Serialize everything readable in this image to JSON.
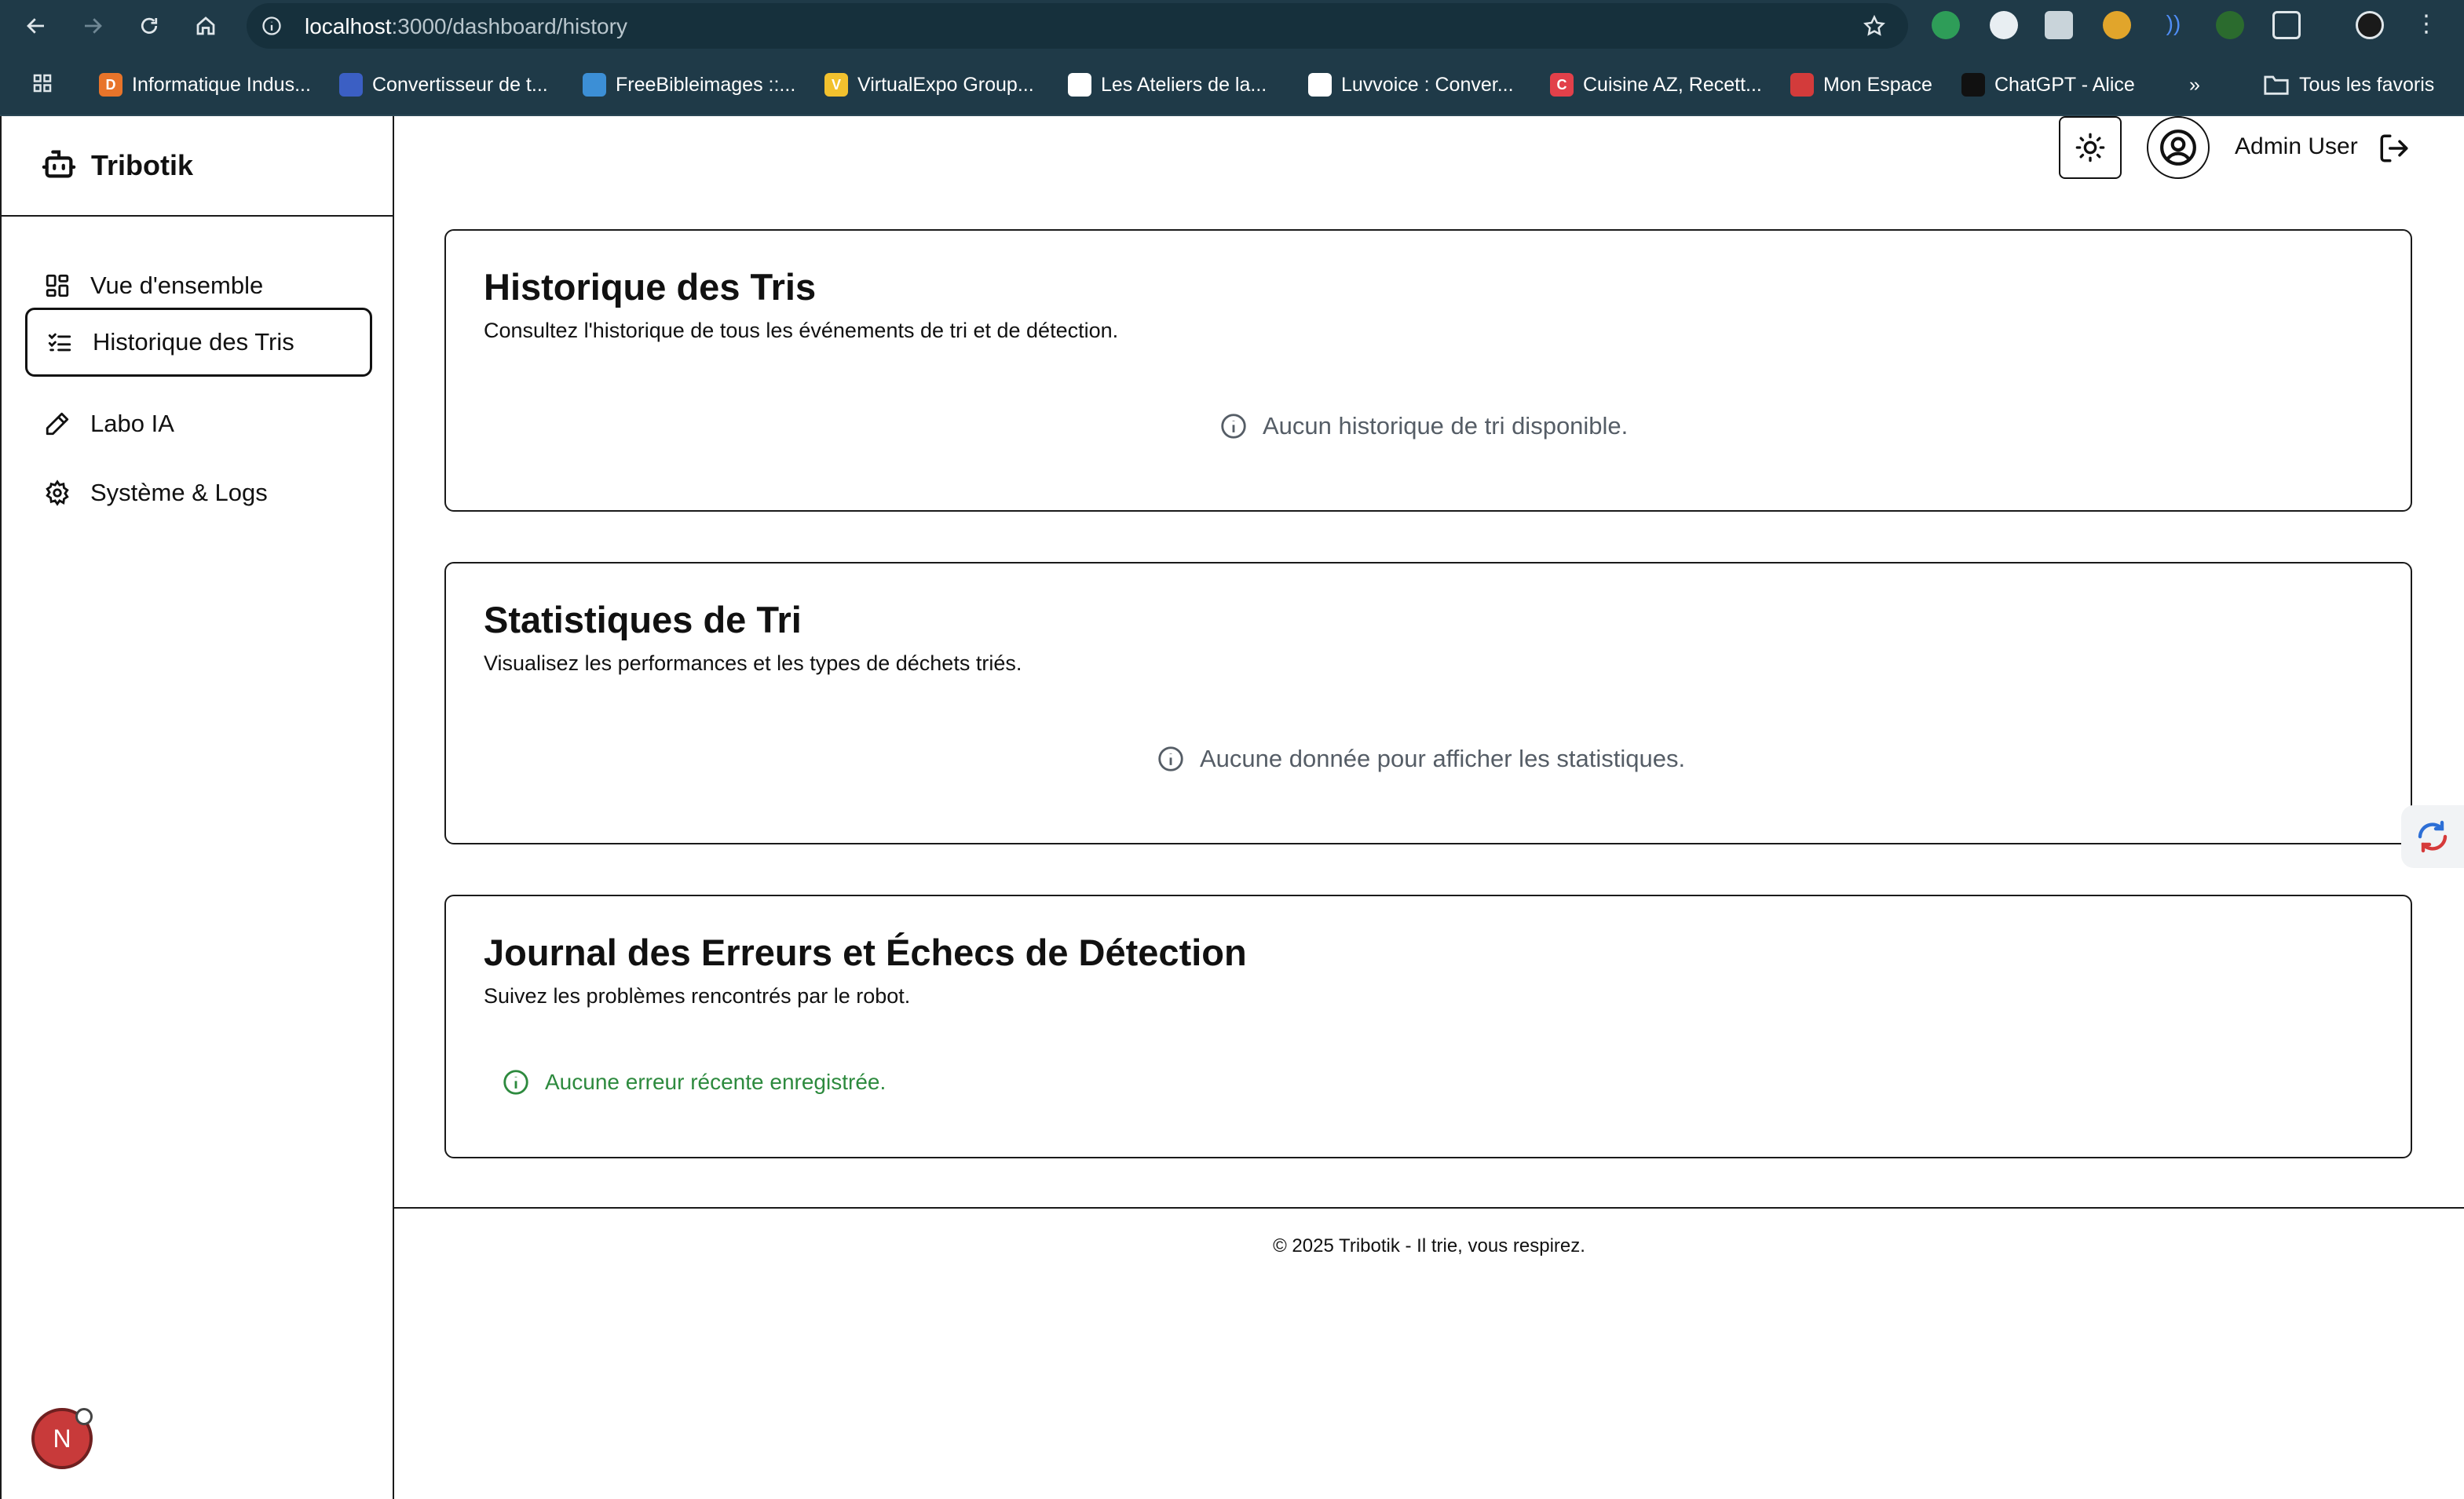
{
  "browser": {
    "url_host": "localhost",
    "url_path": ":3000/dashboard/history",
    "bookmarks": [
      {
        "label": "Informatique Indus...",
        "color": "#e8742a",
        "glyph": "D"
      },
      {
        "label": "Convertisseur de t...",
        "color": "#3b5fc4",
        "glyph": ""
      },
      {
        "label": "FreeBibleimages ::...",
        "color": "#3c8fd6",
        "glyph": ""
      },
      {
        "label": "VirtualExpo Group...",
        "color": "#f2c12e",
        "glyph": "V"
      },
      {
        "label": "Les Ateliers de la...",
        "color": "#ffffff",
        "glyph": ""
      },
      {
        "label": "Luvvoice : Conver...",
        "color": "#ffffff",
        "glyph": ""
      },
      {
        "label": "Cuisine AZ, Recett...",
        "color": "#e2404a",
        "glyph": "C"
      },
      {
        "label": "Mon Espace",
        "color": "#d33b3b",
        "glyph": ""
      },
      {
        "label": "ChatGPT - Alice",
        "color": "#111111",
        "glyph": ""
      }
    ],
    "all_bookmarks_label": "Tous les favoris"
  },
  "sidebar": {
    "brand": "Tribotik",
    "items": [
      {
        "label": "Vue d'ensemble",
        "icon": "dashboard-icon",
        "active": false
      },
      {
        "label": "Historique des Tris",
        "icon": "list-check-icon",
        "active": true
      },
      {
        "label": "Labo IA",
        "icon": "pencil-icon",
        "active": false
      },
      {
        "label": "Système & Logs",
        "icon": "gear-icon",
        "active": false
      }
    ],
    "avatar_letter": "N"
  },
  "header": {
    "user_name": "Admin User"
  },
  "cards": [
    {
      "title": "Historique des Tris",
      "description": "Consultez l'historique de tous les événements de tri et de détection.",
      "empty_message": "Aucun historique de tri disponible."
    },
    {
      "title": "Statistiques de Tri",
      "description": "Visualisez les performances et les types de déchets triés.",
      "empty_message": "Aucune donnée pour afficher les statistiques."
    },
    {
      "title": "Journal des Erreurs et Échecs de Détection",
      "description": "Suivez les problèmes rencontrés par le robot.",
      "empty_message": "Aucune erreur récente enregistrée."
    }
  ],
  "footer": {
    "text": "© 2025 Tribotik - Il trie, vous respirez."
  },
  "colors": {
    "chrome": "#1f3a48",
    "success": "#2d8a3e",
    "muted": "#555d66"
  }
}
